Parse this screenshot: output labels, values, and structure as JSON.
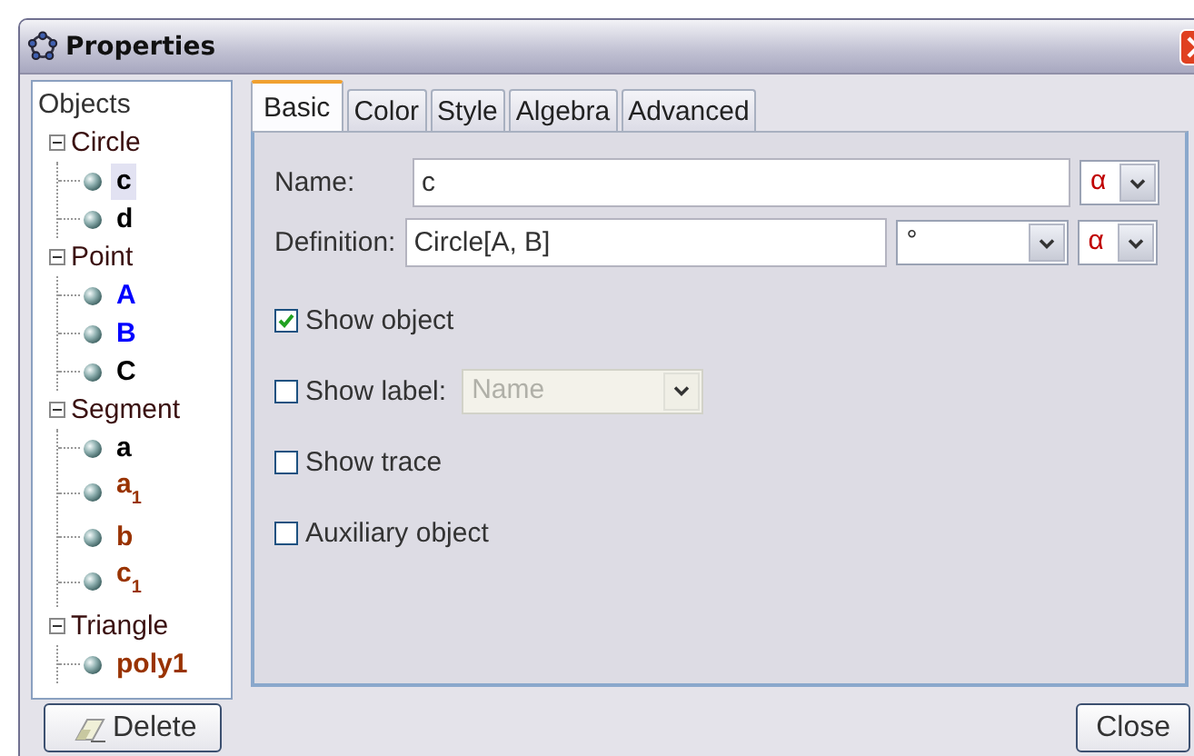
{
  "window": {
    "title": "Properties"
  },
  "tree": {
    "root": "Objects",
    "groups": [
      {
        "label": "Circle",
        "expanded": true,
        "children": [
          {
            "label": "c",
            "color": "#000000",
            "selected": true
          },
          {
            "label": "d",
            "color": "#000000",
            "selected": false
          }
        ]
      },
      {
        "label": "Point",
        "expanded": true,
        "children": [
          {
            "label": "A",
            "color": "#0000ff",
            "selected": false
          },
          {
            "label": "B",
            "color": "#0000ff",
            "selected": false
          },
          {
            "label": "C",
            "color": "#000000",
            "selected": false
          }
        ]
      },
      {
        "label": "Segment",
        "expanded": true,
        "children": [
          {
            "label": "a",
            "color": "#000000",
            "selected": false
          },
          {
            "label": "a$_{1}$",
            "color": "#993300",
            "selected": false
          },
          {
            "label": "b",
            "color": "#993300",
            "selected": false
          },
          {
            "label": "c$_{1}$",
            "color": "#993300",
            "selected": false
          }
        ]
      },
      {
        "label": "Triangle",
        "expanded": true,
        "children": [
          {
            "label": "poly1",
            "color": "#993300",
            "selected": false
          }
        ]
      }
    ]
  },
  "tabs": [
    {
      "label": "Basic",
      "selected": true
    },
    {
      "label": "Color",
      "selected": false
    },
    {
      "label": "Style",
      "selected": false
    },
    {
      "label": "Algebra",
      "selected": false
    },
    {
      "label": "Advanced",
      "selected": false
    }
  ],
  "name_field": {
    "label": "Name:",
    "value": "c",
    "symbol_menu": "α"
  },
  "definition_field": {
    "label": "Definition:",
    "value": "Circle[A, B]",
    "unit_menu": "°",
    "symbol_menu": "α"
  },
  "checkboxes": [
    {
      "label": "Show object",
      "checked": true
    },
    {
      "label": "Show label:",
      "checked": false,
      "menu": {
        "value": "Name",
        "disabled": true
      }
    },
    {
      "label": "Show trace",
      "checked": false
    },
    {
      "label": "Auxiliary object",
      "checked": false
    }
  ],
  "buttons": [
    {
      "label": "Delete",
      "kind": "delete"
    },
    {
      "label": "Close",
      "kind": "plain"
    }
  ]
}
